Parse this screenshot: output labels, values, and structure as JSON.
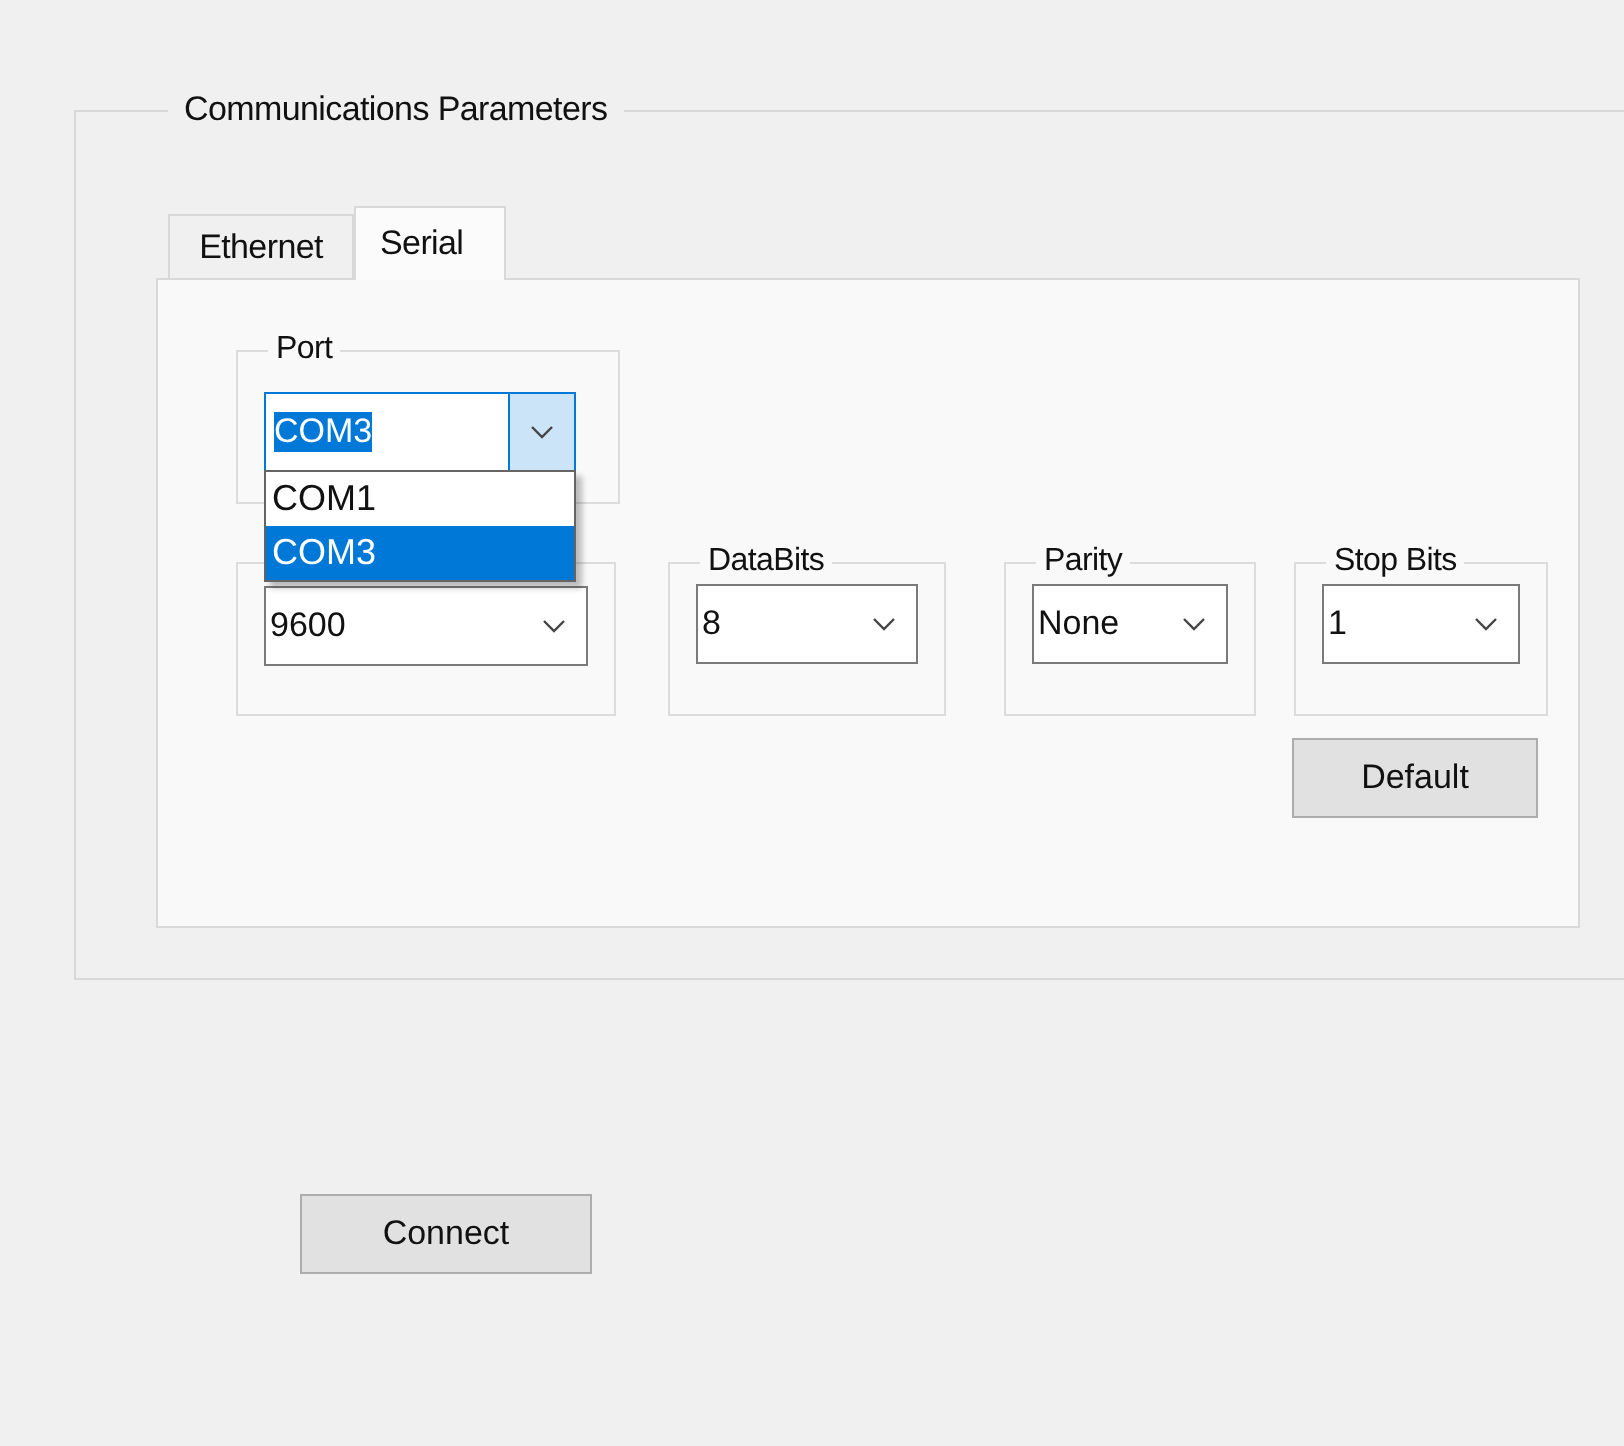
{
  "group": {
    "title": "Communications Parameters"
  },
  "tabs": [
    {
      "label": "Ethernet",
      "selected": false
    },
    {
      "label": "Serial",
      "selected": true
    }
  ],
  "port": {
    "label": "Port",
    "value": "COM3",
    "expanded": true,
    "options": [
      {
        "label": "COM1",
        "selected": false
      },
      {
        "label": "COM3",
        "selected": true
      }
    ]
  },
  "fields": [
    {
      "value": "9600"
    },
    {
      "label": "DataBits",
      "value": "8"
    },
    {
      "label": "Parity",
      "value": "None"
    },
    {
      "label": "Stop Bits",
      "value": "1"
    }
  ],
  "default_button": "Default",
  "connect_button": "Connect"
}
